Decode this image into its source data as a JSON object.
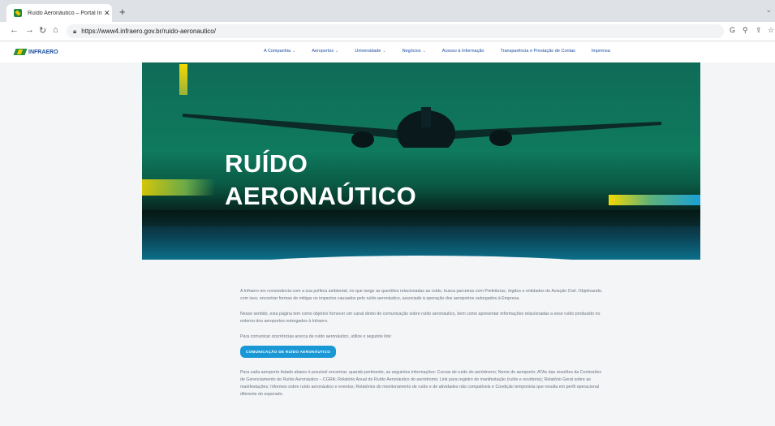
{
  "browser": {
    "tab_title": "Ruído Aeronáutico – Portal Infra",
    "tab_close": "✕",
    "new_tab": "+",
    "url": "https://www4.infraero.gov.br/ruido-aeronautico/",
    "right_tools": [
      "G",
      "⚲",
      "⇪",
      "☆"
    ]
  },
  "site": {
    "logo_text": "INFRAERO",
    "menu": [
      {
        "label": "A Companhia",
        "has_caret": true
      },
      {
        "label": "Aeroportos",
        "has_caret": true
      },
      {
        "label": "Universidade",
        "has_caret": true
      },
      {
        "label": "Negócios",
        "has_caret": true
      },
      {
        "label": "Acesso à Informação",
        "has_caret": false
      },
      {
        "label": "Transparência e Prestação de Contas",
        "has_caret": false
      },
      {
        "label": "Imprensa",
        "has_caret": false
      }
    ]
  },
  "hero": {
    "title_line1": "RUÍDO",
    "title_line2": "AERONAÚTICO"
  },
  "content": {
    "p1": "A Infraero em consonância com a sua política ambiental, no que tange as questões relacionadas ao ruído, busca parceiras com Prefeituras, órgãos e entidades de Aviação Civil. Objetivando, com isso, encontrar formas de mitigar os impactos causados pelo ruído aeronáutico, associado à operação dos aeroportos outorgados à Empresa.",
    "p2": "Nesse sentido, esta página tem como objetivo fornecer um canal direto de comunicação sobre ruído aeronáutico, bem como apresentar informações relacionadas a esse ruído produzido no entorno dos aeroportos outorgados à Infraero.",
    "p3": "Para comunicar ocorrências acerca de ruído aeronáutico, utilize o seguinte link:",
    "cta_label": "COMUNICAÇÃO DE RUÍDO AERONÁUTICO",
    "p4": "Para cada aeroporto listado abaixo é possível encontrar, quando pertinente, as seguintes informações: Curvas de ruído do aeródromo; Nome do aeroporto; ATAs das reuniões da Comissões de Gerenciamento de Ruído Aeronáutico – CGRA; Relatório Anual de Ruído Aeronáutico do aeródromo; Link para registro de manifestação (ruído e ouvidoria); Relatório Geral sobre as manifestações; Informes sobre ruído aeronáutico e eventos; Relatórios do monitoramento de ruído e de atividades não compatíveis e Condição temporária que resulta em perfil operacional diferente do esperado."
  },
  "colors": {
    "brand_blue": "#1d4fa0",
    "cta_blue": "#1a98d6",
    "hero_green": "#0f7a5e"
  }
}
